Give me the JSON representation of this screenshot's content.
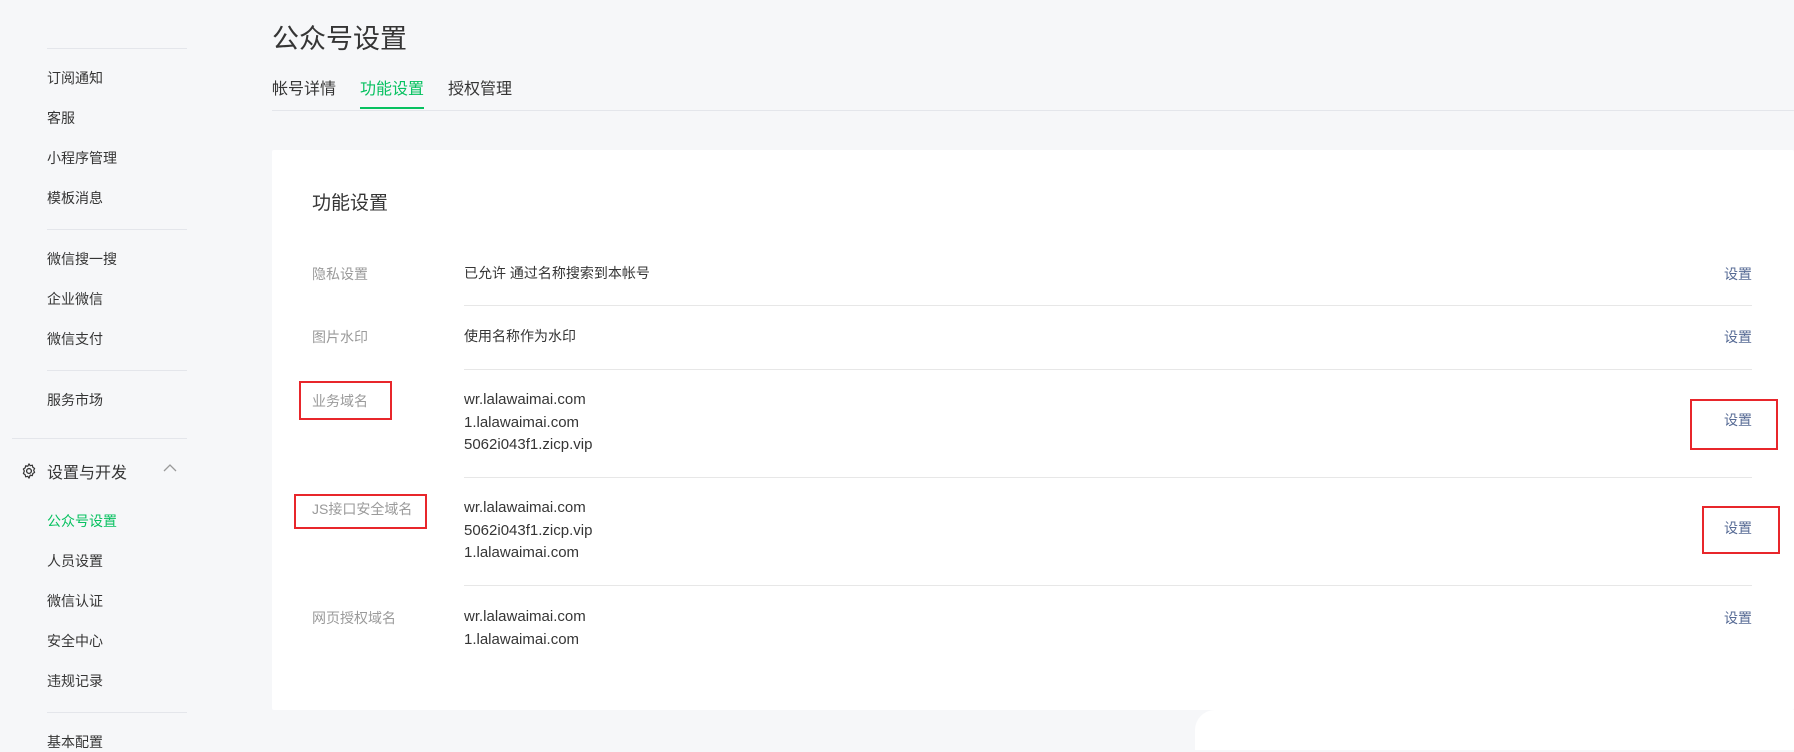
{
  "sidebar": {
    "items": [
      {
        "label": "订阅通知"
      },
      {
        "label": "客服"
      },
      {
        "label": "小程序管理"
      },
      {
        "label": "模板消息"
      },
      {
        "label": "微信搜一搜"
      },
      {
        "label": "企业微信"
      },
      {
        "label": "微信支付"
      },
      {
        "label": "服务市场"
      }
    ],
    "group": {
      "label": "设置与开发",
      "icon": "gear-icon"
    },
    "sub_items": [
      {
        "label": "公众号设置",
        "active": true
      },
      {
        "label": "人员设置"
      },
      {
        "label": "微信认证"
      },
      {
        "label": "安全中心"
      },
      {
        "label": "违规记录"
      },
      {
        "label": "基本配置"
      }
    ]
  },
  "header": {
    "title": "公众号设置",
    "tabs": [
      {
        "label": "帐号详情"
      },
      {
        "label": "功能设置",
        "active": true
      },
      {
        "label": "授权管理"
      }
    ]
  },
  "card": {
    "title": "功能设置",
    "rows": [
      {
        "label": "隐私设置",
        "values": [
          "已允许 通过名称搜索到本帐号"
        ],
        "action": "设置"
      },
      {
        "label": "图片水印",
        "values": [
          "使用名称作为水印"
        ],
        "action": "设置"
      },
      {
        "label": "业务域名",
        "values": [
          "wr.lalawaimai.com",
          "1.lalawaimai.com",
          "5062i043f1.zicp.vip"
        ],
        "action": "设置"
      },
      {
        "label": "JS接口安全域名",
        "values": [
          "wr.lalawaimai.com",
          "5062i043f1.zicp.vip",
          "1.lalawaimai.com"
        ],
        "action": "设置"
      },
      {
        "label": "网页授权域名",
        "values": [
          "wr.lalawaimai.com",
          "1.lalawaimai.com"
        ],
        "action": "设置"
      }
    ]
  },
  "colors": {
    "accent": "#07c160",
    "link": "#576b95",
    "highlight_box": "#e8262b"
  }
}
